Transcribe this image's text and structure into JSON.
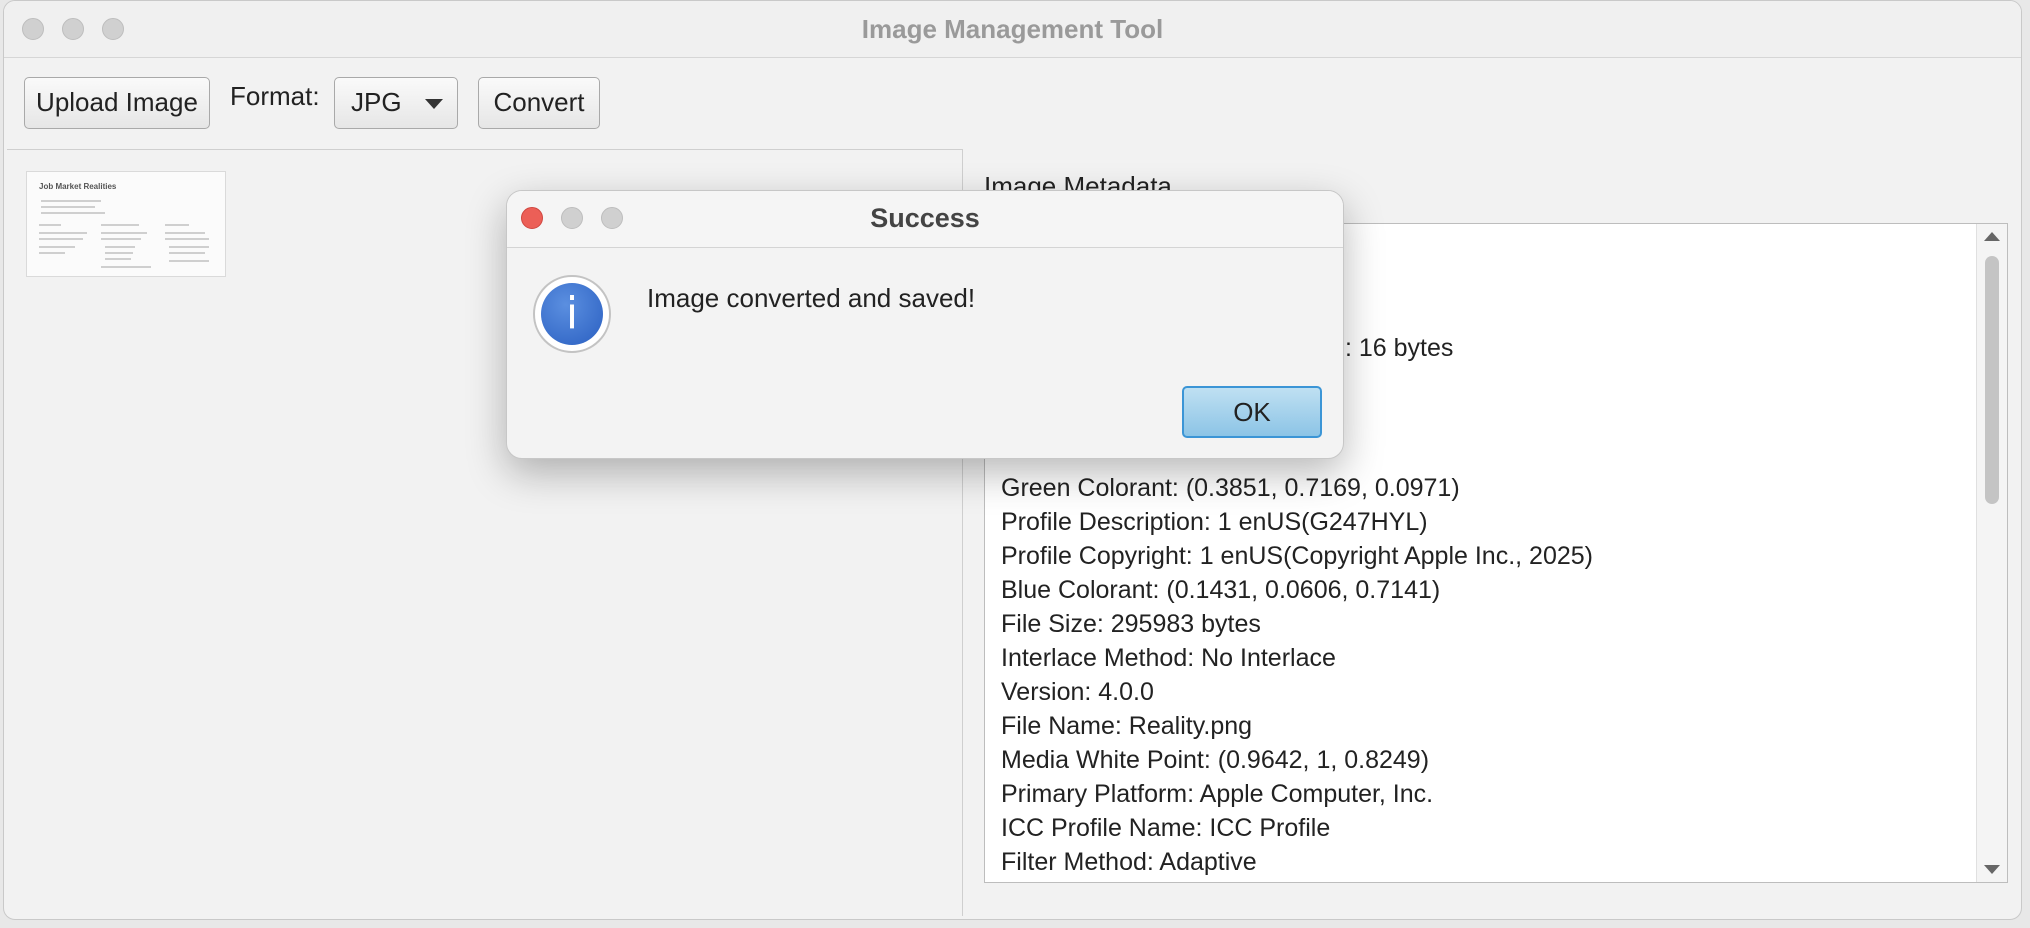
{
  "window": {
    "title": "Image Management Tool"
  },
  "toolbar": {
    "upload_label": "Upload Image",
    "format_label": "Format:",
    "format_value": "JPG",
    "convert_label": "Convert"
  },
  "thumbnail": {
    "title": "Job Market Realities"
  },
  "metadata": {
    "heading": "Image Metadata",
    "partial_line": ": 16 bytes",
    "lines": [
      "Green Colorant: (0.3851, 0.7169, 0.0971)",
      "Profile Description: 1 enUS(G247HYL)",
      "Profile Copyright: 1 enUS(Copyright Apple Inc., 2025)",
      "Blue Colorant: (0.1431, 0.0606, 0.7141)",
      "File Size: 295983 bytes",
      "Interlace Method: No Interlace",
      "Version: 4.0.0",
      "File Name: Reality.png",
      "Media White Point: (0.9642, 1, 0.8249)",
      "Primary Platform: Apple Computer, Inc.",
      "ICC Profile Name: ICC Profile",
      "Filter Method: Adaptive"
    ]
  },
  "dialog": {
    "title": "Success",
    "message": "Image converted and saved!",
    "ok_label": "OK",
    "icon": "info-icon"
  },
  "colors": {
    "close_red": "#ec5f57",
    "ok_blue": "#3b95d6",
    "info_blue": "#2a5fc1"
  }
}
